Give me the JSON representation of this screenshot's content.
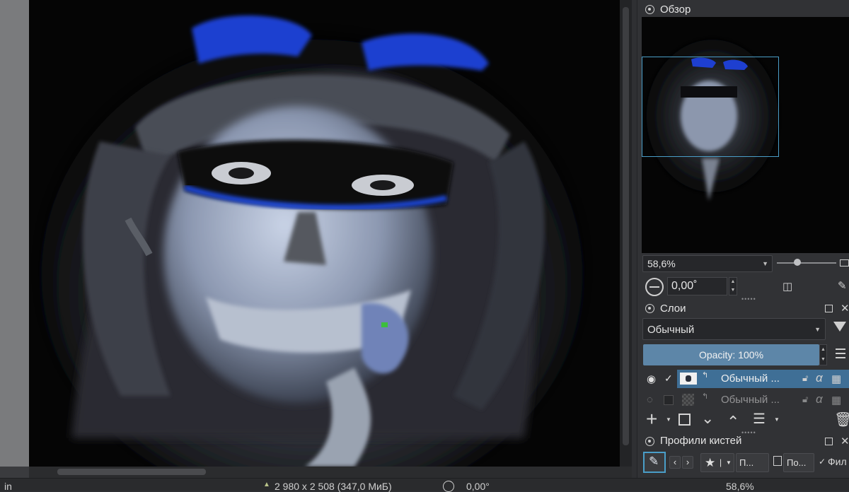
{
  "overview": {
    "title": "Обзор",
    "zoom_value": "58,6%",
    "rotation_value": "0,00˚"
  },
  "layers": {
    "title": "Слои",
    "blend_mode": "Обычный",
    "opacity_label": "Opacity: 100%",
    "rows": [
      {
        "name": "Обычный ...",
        "selected": true,
        "visible": true
      },
      {
        "name": "Обычный ...",
        "selected": false,
        "visible": false
      }
    ]
  },
  "brushes": {
    "title": "Профили кистей",
    "star_label": "★",
    "preset_btn_label": "П...",
    "po_label": "По...",
    "filter_label": "Фил"
  },
  "statusbar": {
    "left_text": "in",
    "image_size": "2 980 x 2 508 (347,0 МиБ)",
    "rotation": "0,00°",
    "zoom": "58,6%"
  },
  "colors": {
    "accent": "#5d86a8",
    "selection": "#3f6f96",
    "view_frame": "#4a9ec8",
    "paint_blue": "#1e3fd0"
  }
}
